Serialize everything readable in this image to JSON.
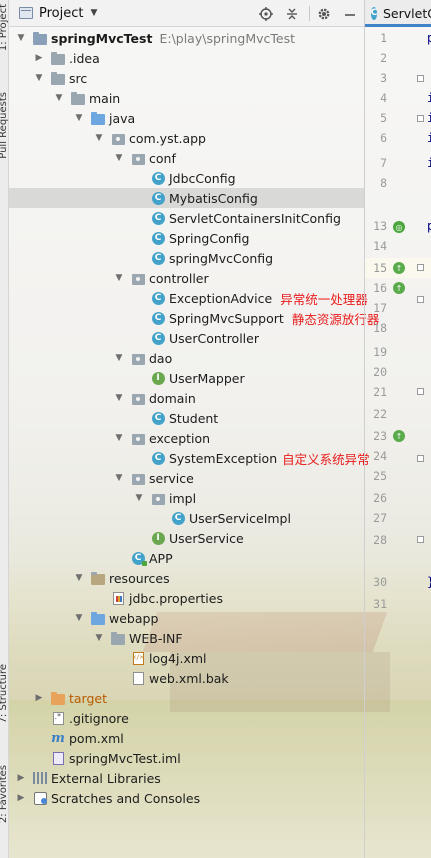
{
  "left_stripe": {
    "tabs": [
      "1: Project",
      "Pull Requests",
      "7: Structure",
      "2: Favorites"
    ]
  },
  "project_panel": {
    "title": "Project",
    "header_icons": [
      "target-icon",
      "collapse-icon",
      "gear-icon",
      "minimize-icon"
    ]
  },
  "tree": {
    "root": {
      "label": "springMvcTest",
      "path": "E:\\play\\springMvcTest"
    },
    "idea": ".idea",
    "src": "src",
    "main": "main",
    "java": "java",
    "pkg_root": "com.yst.app",
    "conf": "conf",
    "conf_items": [
      "JdbcConfig",
      "MybatisConfig",
      "ServletContainersInitConfig",
      "SpringConfig",
      "springMvcConfig"
    ],
    "controller": "controller",
    "controller_items": [
      {
        "label": "ExceptionAdvice",
        "note": "异常统一处理器"
      },
      {
        "label": "SpringMvcSupport",
        "note": "静态资源放行器"
      },
      {
        "label": "UserController",
        "note": ""
      }
    ],
    "dao": "dao",
    "dao_items": [
      "UserMapper"
    ],
    "domain": "domain",
    "domain_items": [
      "Student"
    ],
    "exception": "exception",
    "exception_items": [
      {
        "label": "SystemException",
        "note": "自定义系统异常"
      }
    ],
    "service": "service",
    "impl": "impl",
    "impl_items": [
      "UserServiceImpl"
    ],
    "service_items": [
      "UserService"
    ],
    "app": "APP",
    "resources": "resources",
    "resources_items": [
      "jdbc.properties"
    ],
    "webapp": "webapp",
    "webinf": "WEB-INF",
    "webinf_items": [
      "log4j.xml",
      "web.xml.bak"
    ],
    "target": "target",
    "gitignore": ".gitignore",
    "pom": "pom.xml",
    "iml": "springMvcTest.iml",
    "external_libraries": "External Libraries",
    "scratches": "Scratches and Consoles"
  },
  "editor": {
    "tab_label": "ServletCo",
    "line_numbers": [
      "1",
      "2",
      "3",
      "4",
      "5",
      "6",
      "7",
      "8",
      "13",
      "14",
      "15",
      "16",
      "17",
      "18",
      "19",
      "20",
      "21",
      "22",
      "23",
      "24",
      "25",
      "26",
      "27",
      "28",
      "30",
      "31"
    ],
    "code_chars": {
      "1": "p",
      "4": "i",
      "5": "i",
      "6": "i",
      "7": "i",
      "13": "p",
      "30": "}"
    }
  },
  "colors": {
    "annotation": "#e81c1c",
    "class_icon": "#43a2c9",
    "interface_icon": "#6aa84f",
    "selection": "#d4d4d4"
  }
}
